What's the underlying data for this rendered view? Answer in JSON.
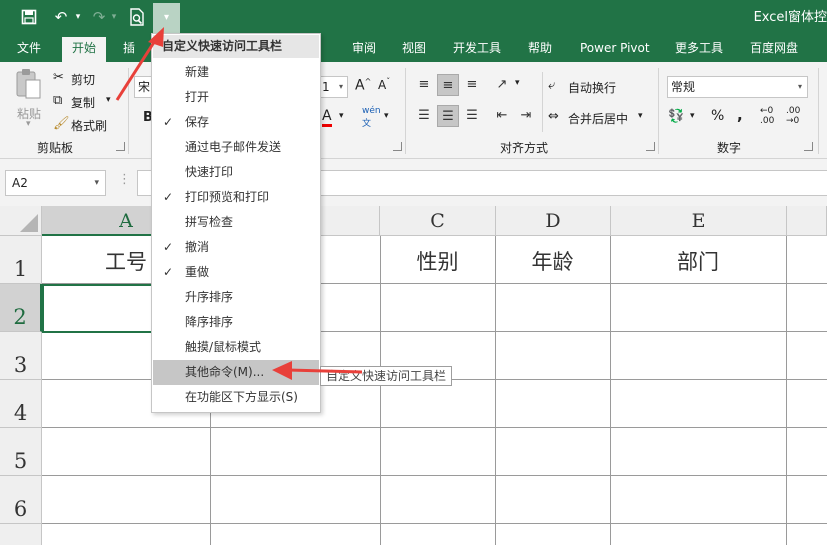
{
  "app_title": "Excel窗体控",
  "quick_access": {
    "save_icon": "save-icon",
    "undo_icon": "undo-icon",
    "redo_icon": "redo-icon",
    "preview_icon": "print-preview-icon",
    "customize_icon": "customize-dropdown-icon"
  },
  "tabs": [
    "文件",
    "开始",
    "插",
    "审阅",
    "视图",
    "开发工具",
    "帮助",
    "Power Pivot",
    "更多工具",
    "百度网盘"
  ],
  "ribbon": {
    "clipboard": {
      "paste": "粘贴",
      "cut": "剪切",
      "copy": "复制",
      "format_painter": "格式刷",
      "group_label": "剪贴板"
    },
    "font": {
      "font_name": "宋",
      "font_size": "1"
    },
    "alignment": {
      "wrap_text": "自动换行",
      "merge_center": "合并后居中",
      "group_label": "对齐方式"
    },
    "number": {
      "format": "常规",
      "percent": "%",
      "comma": ",",
      "group_label": "数字"
    }
  },
  "formula_bar": {
    "name_box": "A2"
  },
  "grid": {
    "columns": [
      "A",
      "C",
      "D",
      "E"
    ],
    "rows": [
      "1",
      "2",
      "3",
      "4",
      "5",
      "6"
    ],
    "cells": {
      "A1": "工号",
      "C1": "性别",
      "D1": "年龄",
      "E1": "部门"
    }
  },
  "qa_menu": {
    "header": "自定义快速访问工具栏",
    "items": [
      {
        "label": "新建",
        "checked": false
      },
      {
        "label": "打开",
        "checked": false
      },
      {
        "label": "保存",
        "checked": true
      },
      {
        "label": "通过电子邮件发送",
        "checked": false
      },
      {
        "label": "快速打印",
        "checked": false
      },
      {
        "label": "打印预览和打印",
        "checked": true
      },
      {
        "label": "拼写检查",
        "checked": false
      },
      {
        "label": "撤消",
        "checked": true
      },
      {
        "label": "重做",
        "checked": true
      },
      {
        "label": "升序排序",
        "checked": false
      },
      {
        "label": "降序排序",
        "checked": false
      },
      {
        "label": "触摸/鼠标模式",
        "checked": false
      },
      {
        "label": "其他命令(M)...",
        "checked": false
      },
      {
        "label": "在功能区下方显示(S)",
        "checked": false
      }
    ],
    "check_mark": "✓",
    "tooltip": "自定义快速访问工具栏"
  },
  "colors": {
    "excel_green": "#217346",
    "annotation_red": "#e8403a"
  }
}
